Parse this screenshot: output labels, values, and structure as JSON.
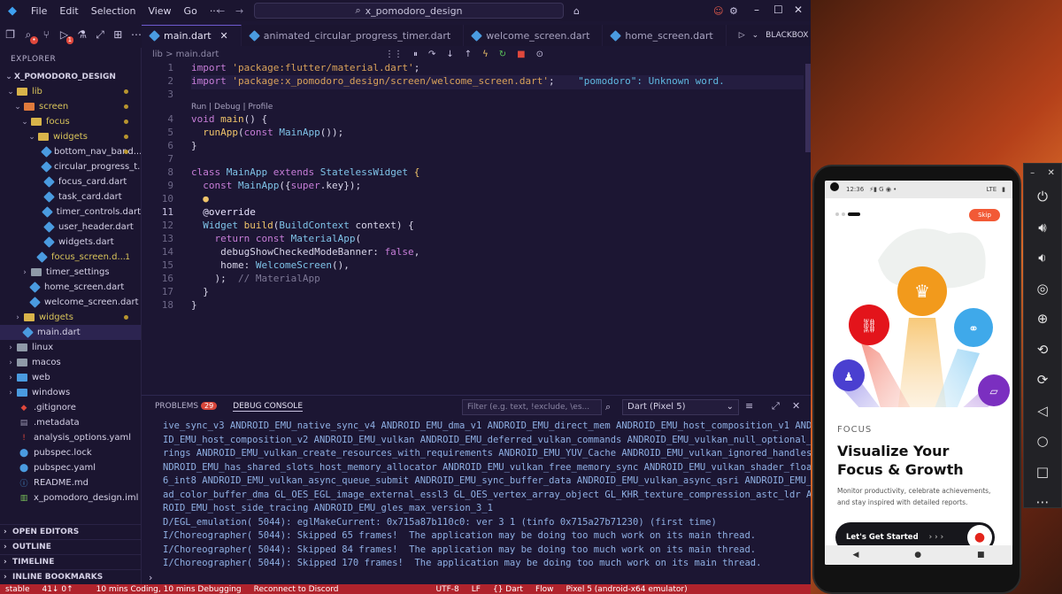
{
  "titlebar": {
    "menus": [
      "File",
      "Edit",
      "Selection",
      "View",
      "Go"
    ],
    "search": "x_pomodoro_design"
  },
  "tabs": [
    {
      "label": "main.dart"
    },
    {
      "label": "animated_circular_progress_timer.dart"
    },
    {
      "label": "welcome_screen.dart"
    },
    {
      "label": "home_screen.dart"
    }
  ],
  "editor_actions": {
    "blackbox": "BLACKBOX"
  },
  "explorer": {
    "header": "EXPLORER",
    "project": "X_POMODORO_DESIGN",
    "items": [
      "lib",
      "screen",
      "focus",
      "widgets",
      "bottom_nav_bar.d...",
      "circular_progress_t...",
      "focus_card.dart",
      "task_card.dart",
      "timer_controls.dart",
      "user_header.dart",
      "widgets.dart",
      "focus_screen.d...",
      "timer_settings",
      "home_screen.dart",
      "welcome_screen.dart",
      "widgets",
      "main.dart",
      "linux",
      "macos",
      "web",
      "windows",
      ".gitignore",
      ".metadata",
      "analysis_options.yaml",
      "pubspec.lock",
      "pubspec.yaml",
      "README.md",
      "x_pomodoro_design.iml"
    ],
    "focus_screen_badge": "1",
    "sections": [
      "OPEN EDITORS",
      "OUTLINE",
      "TIMELINE",
      "INLINE BOOKMARKS"
    ]
  },
  "breadcrumb": "lib > main.dart",
  "code": {
    "line1_kw": "import",
    "line1_str": "'package:flutter/material.dart'",
    "line2_kw": "import",
    "line2_str": "'package:x_pomodoro_design/screen/welcome_screen.dart'",
    "line2_diag": "\"pomodoro\": Unknown word.",
    "codelens": "Run | Debug | Profile",
    "line4_kw": "void",
    "line4_fn": "main",
    "line4_rest": "() {",
    "line5_fn": "runApp",
    "line5_a": "(",
    "line5_kw": "const",
    "line5_cls": "MainApp",
    "line5_rest": "());",
    "line6": "}",
    "line8_kw": "class",
    "line8_cls": "MainApp",
    "line8_kw2": "extends",
    "line8_cls2": "StatelessWidget",
    "line8_rest": "{",
    "line9_kw": "const",
    "line9_cls": "MainApp",
    "line9_a": "({",
    "line9_kw2": "super",
    "line9_rest": ".key});",
    "line11_ann": "@override",
    "line12_cls": "Widget",
    "line12_fn": "build",
    "line12_a": "(",
    "line12_cls2": "BuildContext",
    "line12_rest": " context) {",
    "line13_kw": "return",
    "line13_kw2": "const",
    "line13_cls": "MaterialApp",
    "line13_rest": "(",
    "line14_p": "debugShowCheckedModeBanner:",
    "line14_bool": "false",
    "line15_p": "home:",
    "line15_cls": "WelcomeScreen",
    "line15_rest": "(),",
    "line16_rest": ");",
    "line16_cm": "// MaterialApp",
    "line17": "}",
    "line18": "}"
  },
  "line_numbers": [
    "1",
    "2",
    "3",
    "4",
    "5",
    "6",
    "7",
    "8",
    "9",
    "10",
    "11",
    "12",
    "13",
    "14",
    "15",
    "16",
    "17",
    "18"
  ],
  "panel": {
    "tab_problems": "PROBLEMS",
    "problems_count": "29",
    "tab_debug": "DEBUG CONSOLE",
    "filter_placeholder": "Filter (e.g. text, !exclude, \\es...",
    "device": "Dart (Pixel 5)",
    "log": [
      "ive_sync_v3 ANDROID_EMU_native_sync_v4 ANDROID_EMU_dma_v1 ANDROID_EMU_direct_mem ANDROID_EMU_host_composition_v1 ANDRO",
      "ID_EMU_host_composition_v2 ANDROID_EMU_vulkan ANDROID_EMU_deferred_vulkan_commands ANDROID_EMU_vulkan_null_optional_st",
      "rings ANDROID_EMU_vulkan_create_resources_with_requirements ANDROID_EMU_YUV_Cache ANDROID_EMU_vulkan_ignored_handles A",
      "NDROID_EMU_has_shared_slots_host_memory_allocator ANDROID_EMU_vulkan_free_memory_sync ANDROID_EMU_vulkan_shader_float1",
      "6_int8 ANDROID_EMU_vulkan_async_queue_submit ANDROID_EMU_sync_buffer_data ANDROID_EMU_vulkan_async_qsri ANDROID_EMU_re",
      "ad_color_buffer_dma GL_OES_EGL_image_external_essl3 GL_OES_vertex_array_object GL_KHR_texture_compression_astc_ldr AND",
      "ROID_EMU_host_side_tracing ANDROID_EMU_gles_max_version_3_1",
      "D/EGL_emulation( 5044): eglMakeCurrent: 0x715a87b110c0: ver 3 1 (tinfo 0x715a27b71230) (first time)",
      "I/Choreographer( 5044): Skipped 65 frames!  The application may be doing too much work on its main thread.",
      "I/Choreographer( 5044): Skipped 84 frames!  The application may be doing too much work on its main thread.",
      "I/Choreographer( 5044): Skipped 170 frames!  The application may be doing too much work on its main thread."
    ]
  },
  "statusbar": {
    "items": [
      "stable",
      "41↓ 0↑",
      "10 mins Coding, 10 mins Debugging",
      "Reconnect to Discord",
      "UTF-8",
      "LF",
      "{} Dart",
      "Flow",
      "Pixel 5 (android-x64 emulator)"
    ]
  },
  "phone": {
    "time": "12:36",
    "signal": "LTE",
    "skip": "Skip",
    "focus_label": "FOCUS",
    "title_line1": "Visualize Your",
    "title_line2": "Focus & Growth",
    "sub_line1": "Monitor productivity, celebrate achievements,",
    "sub_line2": "and stay inspired with detailed reports.",
    "cta": "Let's Get Started",
    "cta_arrows": "› › ›"
  },
  "colors": {
    "accent": "#f25a36",
    "orange_circle": "#f29a1c",
    "red_circle": "#e3141b",
    "blue_circle": "#3fa9ea",
    "indigo_circle": "#4a3fd0",
    "purple_circle": "#7b2fc0",
    "status_red": "#b0232c"
  }
}
